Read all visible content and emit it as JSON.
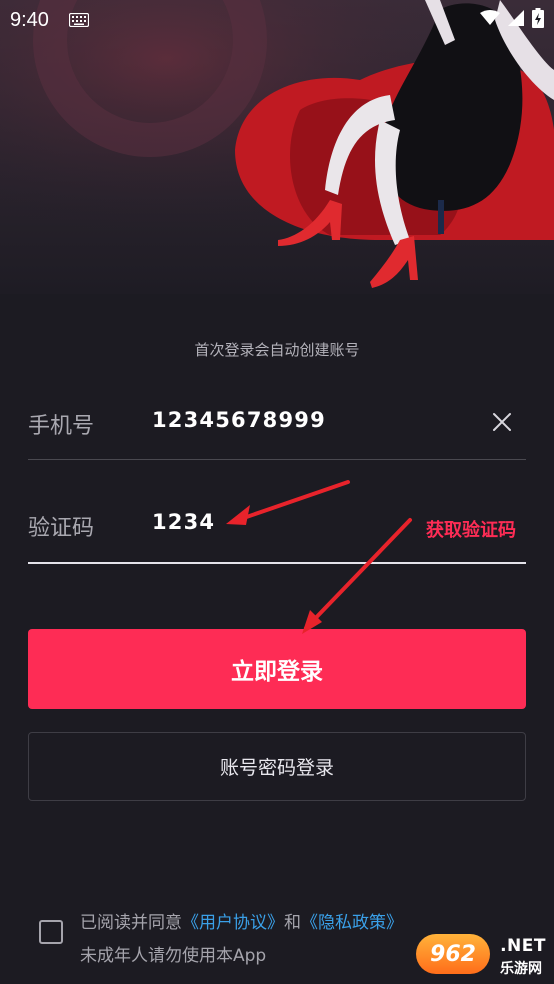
{
  "status_bar": {
    "time": "9:40",
    "icons": [
      "keyboard-icon",
      "wifi-icon",
      "signal-icon",
      "battery-charging-icon"
    ]
  },
  "login": {
    "hint": "首次登录会自动创建账号",
    "phone": {
      "label": "手机号",
      "value": "12345678999"
    },
    "code": {
      "label": "验证码",
      "value": "1234",
      "get_code_label": "获取验证码"
    },
    "submit_label": "立即登录",
    "password_login_label": "账号密码登录"
  },
  "agreement": {
    "prefix": "已阅读并同意",
    "user_agreement": "《用户协议》",
    "and": "和",
    "privacy_policy": "《隐私政策》",
    "minor_notice": "未成年人请勿使用本App"
  },
  "watermark": {
    "badge": "962",
    "domain": ".NET",
    "name": "乐游网"
  },
  "colors": {
    "accent": "#fe2c55",
    "background": "#1c1b22",
    "link": "#3aa0e8",
    "annotation_arrow": "#e8232b"
  }
}
